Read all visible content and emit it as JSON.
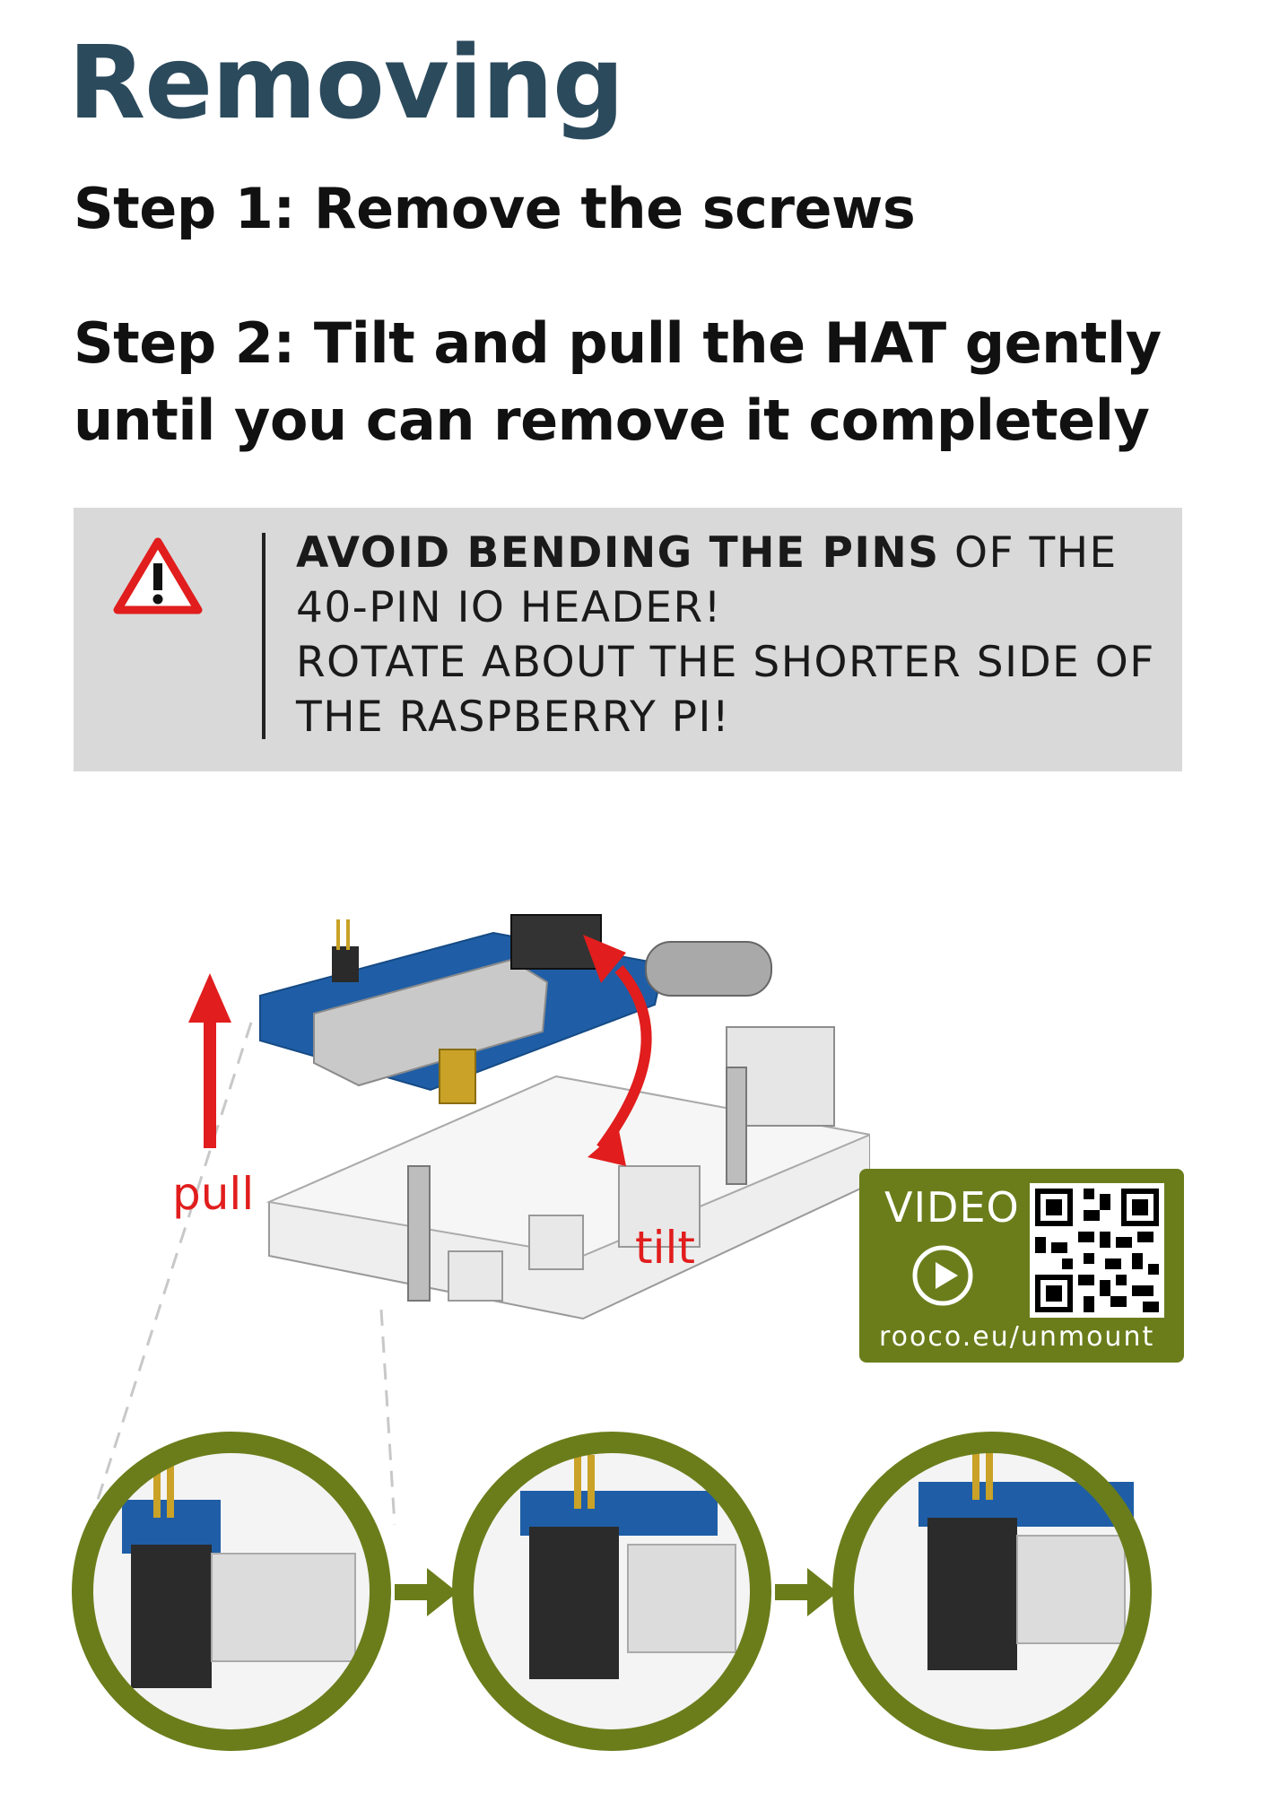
{
  "title": "Removing",
  "step1": "Step 1: Remove the screws",
  "step2_line1": "Step 2: Tilt and pull the HAT gently",
  "step2_line2": "until you can remove it completely",
  "warning": {
    "icon": "warning-triangle-icon",
    "line1_bold": "AVOID BENDING THE PINS",
    "line1_rest": " OF THE",
    "line2": "40-PIN IO HEADER!",
    "line3": "ROTATE ABOUT THE SHORTER SIDE OF",
    "line4": "THE RASPBERRY PI!"
  },
  "illustration": {
    "pull_label": "pull",
    "tilt_label": "tilt"
  },
  "video": {
    "label": "VIDEO",
    "url": "rooco.eu/unmount",
    "icon": "play-icon"
  },
  "colors": {
    "title": "#2b4a5c",
    "accent_green": "#6b7d1b",
    "arrow_red": "#e11d1d",
    "warning_bg": "#d9d9d9"
  }
}
